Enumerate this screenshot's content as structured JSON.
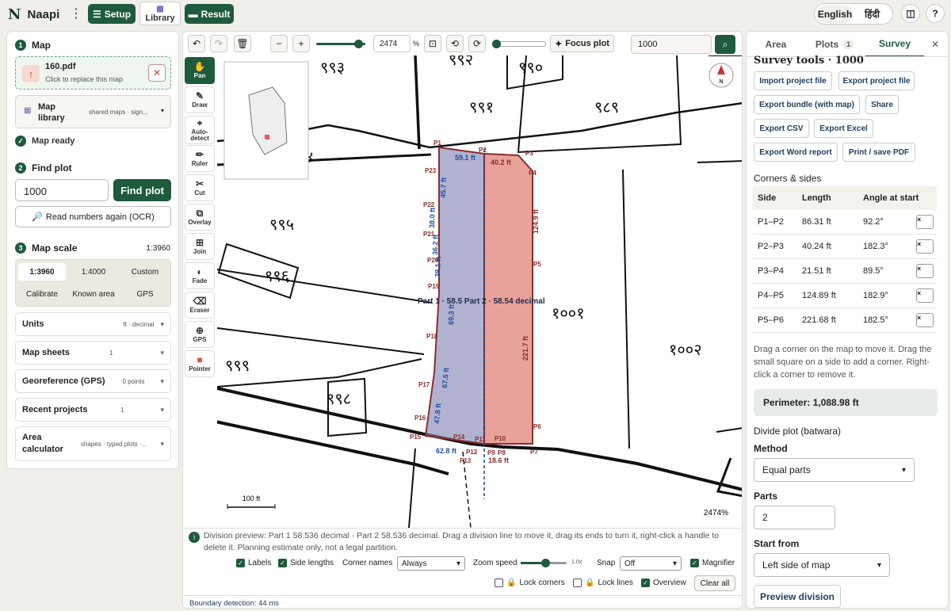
{
  "app": {
    "name": "Naapi",
    "logo_mark": "N"
  },
  "topbar": {
    "setup": "Setup",
    "library": "Library",
    "result": "Result",
    "lang_en": "English",
    "lang_hi": "हिंदी",
    "help": "?"
  },
  "left": {
    "s1_num": "1",
    "s1_title": "Map",
    "file_name": "160.pdf",
    "file_hint": "Click to replace this map",
    "library_label": "Map library",
    "library_meta": "shared maps · sign...",
    "map_ready": "Map ready",
    "s2_num": "2",
    "s2_title": "Find plot",
    "find_value": "1000",
    "find_btn": "Find plot",
    "ocr_btn": "Read numbers again (OCR)",
    "s3_num": "3",
    "s3_title": "Map scale",
    "scale_value": "1:3960",
    "scale_opts": [
      "1:3960",
      "1:4000",
      "Custom"
    ],
    "scale_opts2": [
      "Calibrate",
      "Known area",
      "GPS"
    ],
    "acc": [
      {
        "label": "Units",
        "meta": "ft · decimal"
      },
      {
        "label": "Map sheets",
        "meta": "1"
      },
      {
        "label": "Georeference (GPS)",
        "meta": "0 points"
      },
      {
        "label": "Recent projects",
        "meta": "1"
      },
      {
        "label": "Area calculator",
        "meta": "shapes · typed plots ·..."
      }
    ]
  },
  "map": {
    "zoom_value": "2474",
    "zoom_pct": "%",
    "focus_plot": "Focus plot",
    "search_value": "1000",
    "tools": [
      {
        "label": "Pan",
        "icon": "✋"
      },
      {
        "label": "Draw",
        "icon": "✎"
      },
      {
        "label": "Auto-detect",
        "icon": "⌖"
      },
      {
        "label": "Ruler",
        "icon": "✏"
      },
      {
        "label": "Cut",
        "icon": "✂"
      },
      {
        "label": "Overlay",
        "icon": "⧉"
      },
      {
        "label": "Join",
        "icon": "⊞"
      },
      {
        "label": "Fade",
        "icon": "◐"
      },
      {
        "label": "Eraser",
        "icon": "⌫"
      },
      {
        "label": "GPS",
        "icon": "⊕"
      },
      {
        "label": "Pointer",
        "icon": "■"
      }
    ],
    "plot_numbers": [
      "९९३",
      "९९२",
      "९९०",
      "९९१",
      "९८९",
      "९९४",
      "९९५",
      "९९६",
      "१००१",
      "१००२",
      "९९९",
      "९९८"
    ],
    "part_label": "Part 1 · 58.5 Part 2 · 58.54 decimal",
    "edge_labels": [
      "59.1 ft",
      "40.2 ft",
      "45.7 ft",
      "38.0 ft",
      "36.2 ft",
      "39.1 ft",
      "124.9 ft",
      "69.3 ft",
      "221.7 ft",
      "67.5 ft",
      "47.8 ft",
      "62.8 ft",
      "18.6 ft"
    ],
    "points": [
      "P1",
      "P2",
      "P3",
      "P4",
      "P5",
      "P6",
      "P7",
      "P8",
      "P9",
      "P10",
      "P11",
      "P12",
      "P13",
      "P14",
      "P15",
      "P16",
      "P17",
      "P18",
      "P19",
      "P20",
      "P21",
      "P22",
      "P23"
    ],
    "scale_bar": "100 ft",
    "zoom_readout": "2474%",
    "north": "N",
    "division_info": "Division preview: Part 1 58.536 decimal · Part 2 58.536 decimal. Drag a division line to move it, drag its ends to turn it, right-click a handle to delete it. Planning estimate only, not a legal partition.",
    "opt_labels": "Labels",
    "opt_sides": "Side lengths",
    "corner_names": "Corner names",
    "corner_names_val": "Always",
    "zoom_speed": "Zoom speed",
    "zoom_speed_val": "1.0x",
    "snap": "Snap",
    "snap_val": "Off",
    "magnifier": "Magnifier",
    "lock_corners": "Lock corners",
    "lock_lines": "Lock lines",
    "overview": "Overview",
    "clear_all": "Clear all",
    "boundary": "Boundary detection: 44 ms"
  },
  "right": {
    "tab_area": "Area",
    "tab_plots": "Plots",
    "plots_count": "1",
    "tab_survey": "Survey",
    "title": "Survey tools · 1000",
    "btns": [
      "Import project file",
      "Export project file",
      "Export bundle (with map)",
      "Share",
      "Export CSV",
      "Export Excel",
      "Export Word report",
      "Print / save PDF"
    ],
    "corners_title": "Corners & sides",
    "cols": [
      "Side",
      "Length",
      "Angle at start"
    ],
    "rows": [
      {
        "side": "P1–P2",
        "len": "86.31 ft",
        "ang": "92.2°"
      },
      {
        "side": "P2–P3",
        "len": "40.24 ft",
        "ang": "182.3°"
      },
      {
        "side": "P3–P4",
        "len": "21.51 ft",
        "ang": "89.5°"
      },
      {
        "side": "P4–P5",
        "len": "124.89 ft",
        "ang": "182.9°"
      },
      {
        "side": "P5–P6",
        "len": "221.68 ft",
        "ang": "182.5°"
      }
    ],
    "help": "Drag a corner on the map to move it. Drag the small square on a side to add a corner. Right-click a corner to remove it.",
    "perimeter": "Perimeter: 1,088.98 ft",
    "divide_title": "Divide plot (batwara)",
    "method_lbl": "Method",
    "method_val": "Equal parts",
    "parts_lbl": "Parts",
    "parts_val": "2",
    "start_lbl": "Start from",
    "start_val": "Left side of map",
    "preview_btn": "Preview division"
  }
}
